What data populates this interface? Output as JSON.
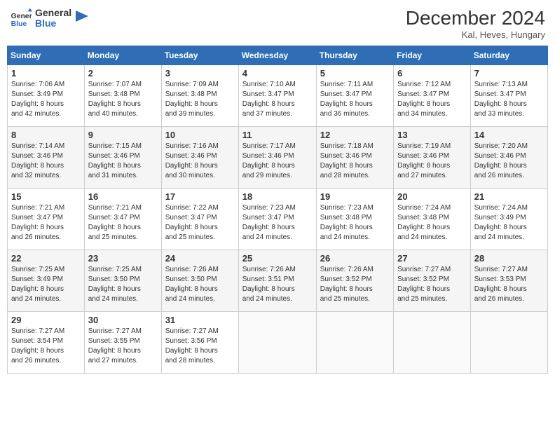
{
  "header": {
    "logo_general": "General",
    "logo_blue": "Blue",
    "month_title": "December 2024",
    "location": "Kal, Heves, Hungary"
  },
  "weekdays": [
    "Sunday",
    "Monday",
    "Tuesday",
    "Wednesday",
    "Thursday",
    "Friday",
    "Saturday"
  ],
  "weeks": [
    [
      {
        "day": "1",
        "sunrise": "7:06 AM",
        "sunset": "3:49 PM",
        "daylight": "8 hours and 42 minutes."
      },
      {
        "day": "2",
        "sunrise": "7:07 AM",
        "sunset": "3:48 PM",
        "daylight": "8 hours and 40 minutes."
      },
      {
        "day": "3",
        "sunrise": "7:09 AM",
        "sunset": "3:48 PM",
        "daylight": "8 hours and 39 minutes."
      },
      {
        "day": "4",
        "sunrise": "7:10 AM",
        "sunset": "3:47 PM",
        "daylight": "8 hours and 37 minutes."
      },
      {
        "day": "5",
        "sunrise": "7:11 AM",
        "sunset": "3:47 PM",
        "daylight": "8 hours and 36 minutes."
      },
      {
        "day": "6",
        "sunrise": "7:12 AM",
        "sunset": "3:47 PM",
        "daylight": "8 hours and 34 minutes."
      },
      {
        "day": "7",
        "sunrise": "7:13 AM",
        "sunset": "3:47 PM",
        "daylight": "8 hours and 33 minutes."
      }
    ],
    [
      {
        "day": "8",
        "sunrise": "7:14 AM",
        "sunset": "3:46 PM",
        "daylight": "8 hours and 32 minutes."
      },
      {
        "day": "9",
        "sunrise": "7:15 AM",
        "sunset": "3:46 PM",
        "daylight": "8 hours and 31 minutes."
      },
      {
        "day": "10",
        "sunrise": "7:16 AM",
        "sunset": "3:46 PM",
        "daylight": "8 hours and 30 minutes."
      },
      {
        "day": "11",
        "sunrise": "7:17 AM",
        "sunset": "3:46 PM",
        "daylight": "8 hours and 29 minutes."
      },
      {
        "day": "12",
        "sunrise": "7:18 AM",
        "sunset": "3:46 PM",
        "daylight": "8 hours and 28 minutes."
      },
      {
        "day": "13",
        "sunrise": "7:19 AM",
        "sunset": "3:46 PM",
        "daylight": "8 hours and 27 minutes."
      },
      {
        "day": "14",
        "sunrise": "7:20 AM",
        "sunset": "3:46 PM",
        "daylight": "8 hours and 26 minutes."
      }
    ],
    [
      {
        "day": "15",
        "sunrise": "7:21 AM",
        "sunset": "3:47 PM",
        "daylight": "8 hours and 26 minutes."
      },
      {
        "day": "16",
        "sunrise": "7:21 AM",
        "sunset": "3:47 PM",
        "daylight": "8 hours and 25 minutes."
      },
      {
        "day": "17",
        "sunrise": "7:22 AM",
        "sunset": "3:47 PM",
        "daylight": "8 hours and 25 minutes."
      },
      {
        "day": "18",
        "sunrise": "7:23 AM",
        "sunset": "3:47 PM",
        "daylight": "8 hours and 24 minutes."
      },
      {
        "day": "19",
        "sunrise": "7:23 AM",
        "sunset": "3:48 PM",
        "daylight": "8 hours and 24 minutes."
      },
      {
        "day": "20",
        "sunrise": "7:24 AM",
        "sunset": "3:48 PM",
        "daylight": "8 hours and 24 minutes."
      },
      {
        "day": "21",
        "sunrise": "7:24 AM",
        "sunset": "3:49 PM",
        "daylight": "8 hours and 24 minutes."
      }
    ],
    [
      {
        "day": "22",
        "sunrise": "7:25 AM",
        "sunset": "3:49 PM",
        "daylight": "8 hours and 24 minutes."
      },
      {
        "day": "23",
        "sunrise": "7:25 AM",
        "sunset": "3:50 PM",
        "daylight": "8 hours and 24 minutes."
      },
      {
        "day": "24",
        "sunrise": "7:26 AM",
        "sunset": "3:50 PM",
        "daylight": "8 hours and 24 minutes."
      },
      {
        "day": "25",
        "sunrise": "7:26 AM",
        "sunset": "3:51 PM",
        "daylight": "8 hours and 24 minutes."
      },
      {
        "day": "26",
        "sunrise": "7:26 AM",
        "sunset": "3:52 PM",
        "daylight": "8 hours and 25 minutes."
      },
      {
        "day": "27",
        "sunrise": "7:27 AM",
        "sunset": "3:52 PM",
        "daylight": "8 hours and 25 minutes."
      },
      {
        "day": "28",
        "sunrise": "7:27 AM",
        "sunset": "3:53 PM",
        "daylight": "8 hours and 26 minutes."
      }
    ],
    [
      {
        "day": "29",
        "sunrise": "7:27 AM",
        "sunset": "3:54 PM",
        "daylight": "8 hours and 26 minutes."
      },
      {
        "day": "30",
        "sunrise": "7:27 AM",
        "sunset": "3:55 PM",
        "daylight": "8 hours and 27 minutes."
      },
      {
        "day": "31",
        "sunrise": "7:27 AM",
        "sunset": "3:56 PM",
        "daylight": "8 hours and 28 minutes."
      },
      null,
      null,
      null,
      null
    ]
  ],
  "labels": {
    "sunrise": "Sunrise:",
    "sunset": "Sunset:",
    "daylight": "Daylight:"
  }
}
